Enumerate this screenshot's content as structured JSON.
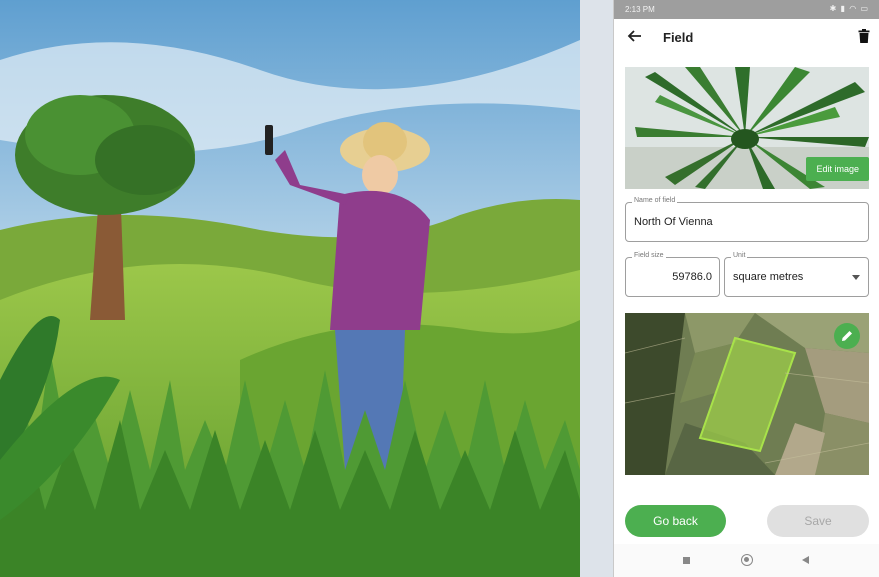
{
  "status_bar": {
    "time": "2:13 PM",
    "icons": [
      "bluetooth-icon",
      "signal-icon",
      "wifi-icon",
      "battery-icon"
    ]
  },
  "app_bar": {
    "title": "Field",
    "back_icon": "arrow-left-icon",
    "delete_icon": "trash-icon"
  },
  "field_image": {
    "edit_label": "Edit image"
  },
  "name_field": {
    "label": "Name of field",
    "value": "North Of Vienna"
  },
  "size_field": {
    "label": "Field size",
    "value": "59786.0"
  },
  "unit_field": {
    "label": "Unit",
    "value": "square metres"
  },
  "map": {
    "edit_icon": "pencil-icon"
  },
  "actions": {
    "go_back_label": "Go back",
    "save_label": "Save",
    "save_enabled": false
  },
  "nav_bar": {
    "icons": [
      "recents-icon",
      "home-icon",
      "back-icon"
    ]
  },
  "colors": {
    "accent": "#4caf50",
    "disabled_button": "#e0e0e0",
    "status_bar": "#9e9e9e"
  }
}
